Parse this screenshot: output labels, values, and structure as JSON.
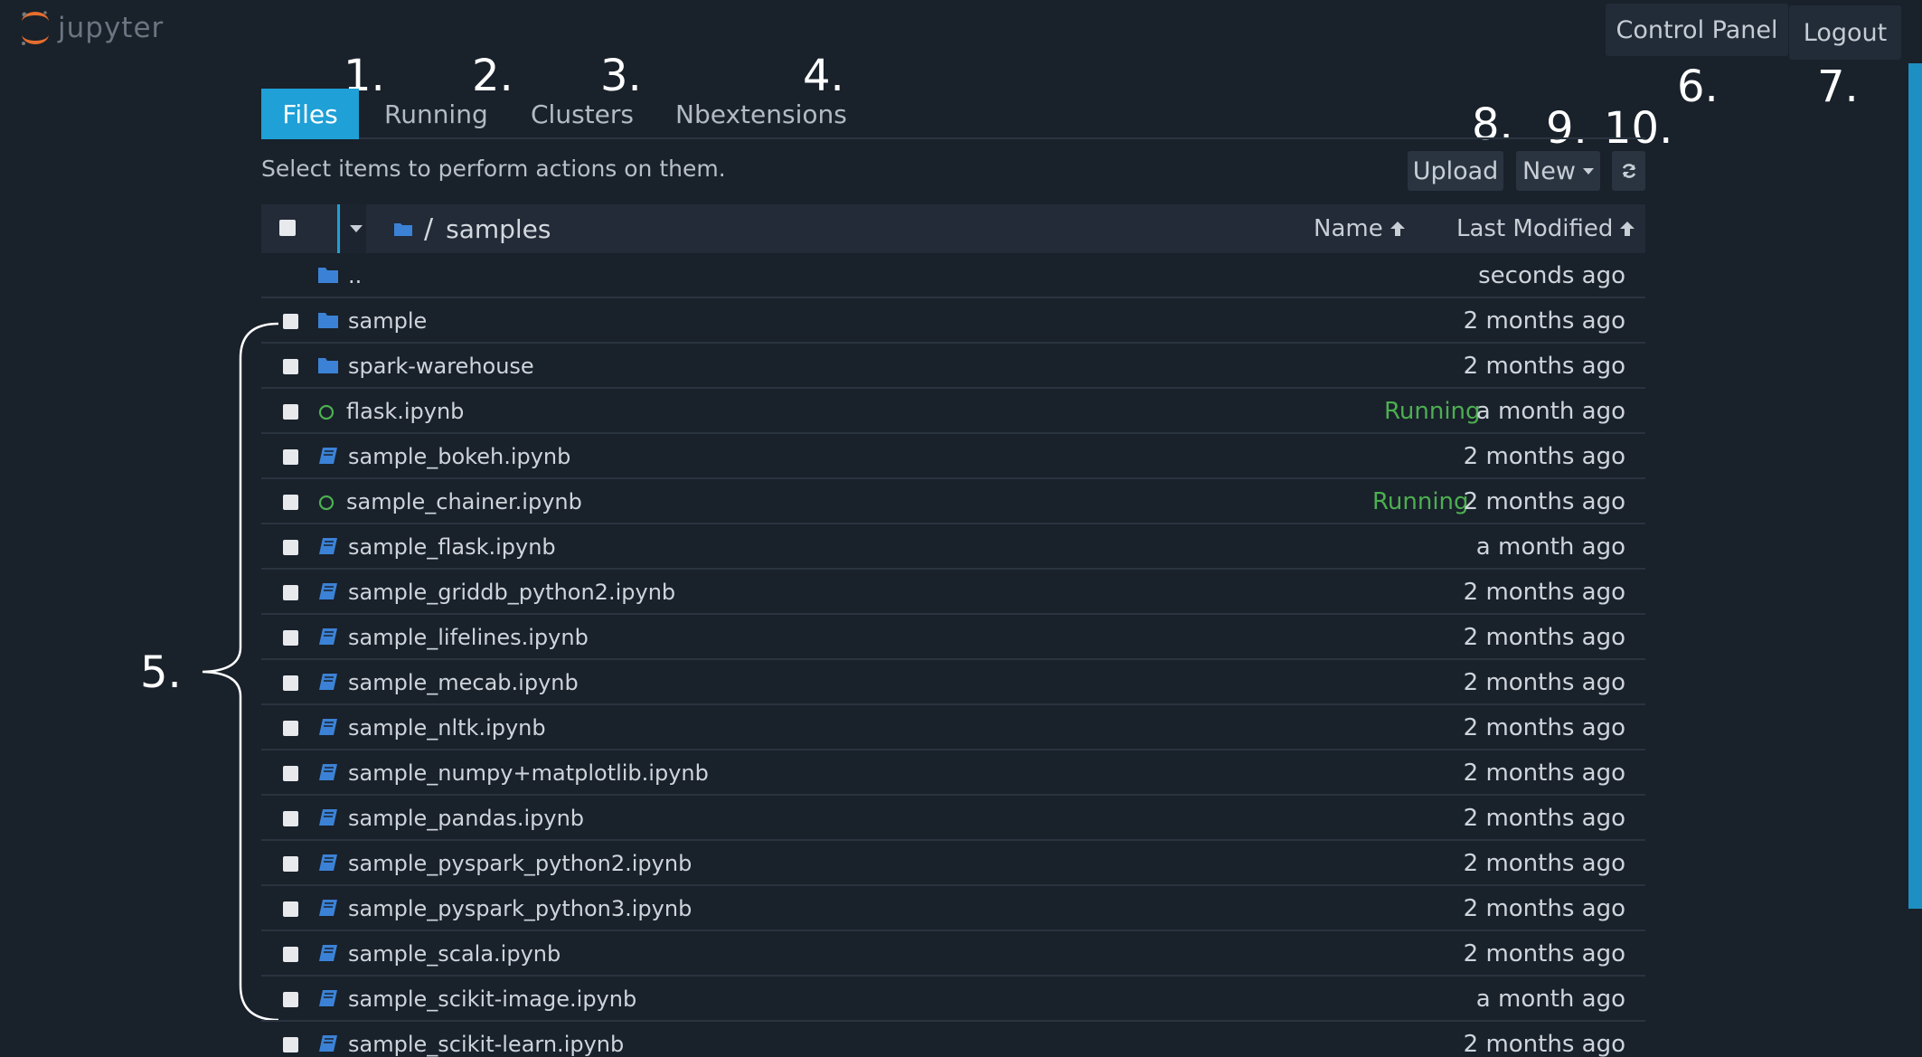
{
  "header": {
    "logo_text": "jupyter",
    "control_panel_label": "Control Panel",
    "logout_label": "Logout"
  },
  "tabs": [
    {
      "label": "Files",
      "active": true
    },
    {
      "label": "Running",
      "active": false
    },
    {
      "label": "Clusters",
      "active": false
    },
    {
      "label": "Nbextensions",
      "active": false
    }
  ],
  "annotations": {
    "a1": "1.",
    "a2": "2.",
    "a3": "3.",
    "a4": "4.",
    "a5": "5.",
    "a6": "6.",
    "a7": "7.",
    "a8": "8.",
    "a9": "9.",
    "a10": "10."
  },
  "toolbar": {
    "hint": "Select items to perform actions on them.",
    "upload_label": "Upload",
    "new_label": "New"
  },
  "list_header": {
    "breadcrumb_sep": "/",
    "breadcrumb_dir": "samples",
    "name_col": "Name",
    "modified_col": "Last Modified"
  },
  "colors": {
    "accent": "#1fa0d6",
    "running": "#4caf50",
    "folder": "#3b82d6",
    "background": "#19212b"
  },
  "files": [
    {
      "name": "..",
      "type": "parent",
      "modified": "seconds ago",
      "status": ""
    },
    {
      "name": "sample",
      "type": "folder",
      "modified": "2 months ago",
      "status": ""
    },
    {
      "name": "spark-warehouse",
      "type": "folder",
      "modified": "2 months ago",
      "status": ""
    },
    {
      "name": "flask.ipynb",
      "type": "notebook-running",
      "modified": "a month ago",
      "status": "Running"
    },
    {
      "name": "sample_bokeh.ipynb",
      "type": "notebook",
      "modified": "2 months ago",
      "status": ""
    },
    {
      "name": "sample_chainer.ipynb",
      "type": "notebook-running",
      "modified": "2 months ago",
      "status": "Running"
    },
    {
      "name": "sample_flask.ipynb",
      "type": "notebook",
      "modified": "a month ago",
      "status": ""
    },
    {
      "name": "sample_griddb_python2.ipynb",
      "type": "notebook",
      "modified": "2 months ago",
      "status": ""
    },
    {
      "name": "sample_lifelines.ipynb",
      "type": "notebook",
      "modified": "2 months ago",
      "status": ""
    },
    {
      "name": "sample_mecab.ipynb",
      "type": "notebook",
      "modified": "2 months ago",
      "status": ""
    },
    {
      "name": "sample_nltk.ipynb",
      "type": "notebook",
      "modified": "2 months ago",
      "status": ""
    },
    {
      "name": "sample_numpy+matplotlib.ipynb",
      "type": "notebook",
      "modified": "2 months ago",
      "status": ""
    },
    {
      "name": "sample_pandas.ipynb",
      "type": "notebook",
      "modified": "2 months ago",
      "status": ""
    },
    {
      "name": "sample_pyspark_python2.ipynb",
      "type": "notebook",
      "modified": "2 months ago",
      "status": ""
    },
    {
      "name": "sample_pyspark_python3.ipynb",
      "type": "notebook",
      "modified": "2 months ago",
      "status": ""
    },
    {
      "name": "sample_scala.ipynb",
      "type": "notebook",
      "modified": "2 months ago",
      "status": ""
    },
    {
      "name": "sample_scikit-image.ipynb",
      "type": "notebook",
      "modified": "a month ago",
      "status": ""
    },
    {
      "name": "sample_scikit-learn.ipynb",
      "type": "notebook",
      "modified": "2 months ago",
      "status": ""
    }
  ]
}
